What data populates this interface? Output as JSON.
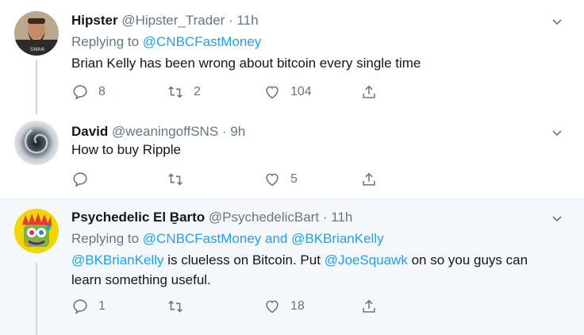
{
  "tweets": [
    {
      "display_name": "Hipster",
      "handle": "@Hipster_Trader",
      "time": "· 11h",
      "replying_prefix": "Replying to ",
      "replying_to": "@CNBCFastMoney",
      "text": "Brian Kelly has been wrong about bitcoin every single time",
      "reply_count": "8",
      "retweet_count": "2",
      "like_count": "104"
    },
    {
      "display_name": "David",
      "handle": "@weaningoffSNS",
      "time": "· 9h",
      "text": "How to buy Ripple",
      "reply_count": "",
      "retweet_count": "",
      "like_count": "5"
    },
    {
      "display_name": "Psychedelic El Ḇarto",
      "handle": "@PsychedelicBart",
      "time": "· 11h",
      "replying_prefix": "Replying to ",
      "replying_to_1": "@CNBCFastMoney",
      "replying_and": " and ",
      "replying_to_2": "@BKBrianKelly",
      "text_mention_1": "@BKBrianKelly",
      "text_part_1": " is clueless on Bitcoin. Put ",
      "text_mention_2": "@JoeSquawk",
      "text_part_2": " on so you guys can",
      "text_line_2": "learn something useful.",
      "reply_count": "1",
      "retweet_count": "",
      "like_count": "18"
    }
  ],
  "colors": {
    "link": "#1da1f2",
    "secondary": "#657786",
    "thread_line": "#ccd6dd",
    "highlight_bg": "#f5f8fa"
  },
  "icons": {
    "reply": "reply-icon",
    "retweet": "retweet-icon",
    "like": "heart-icon",
    "share": "share-icon",
    "caret": "chevron-down-icon"
  }
}
